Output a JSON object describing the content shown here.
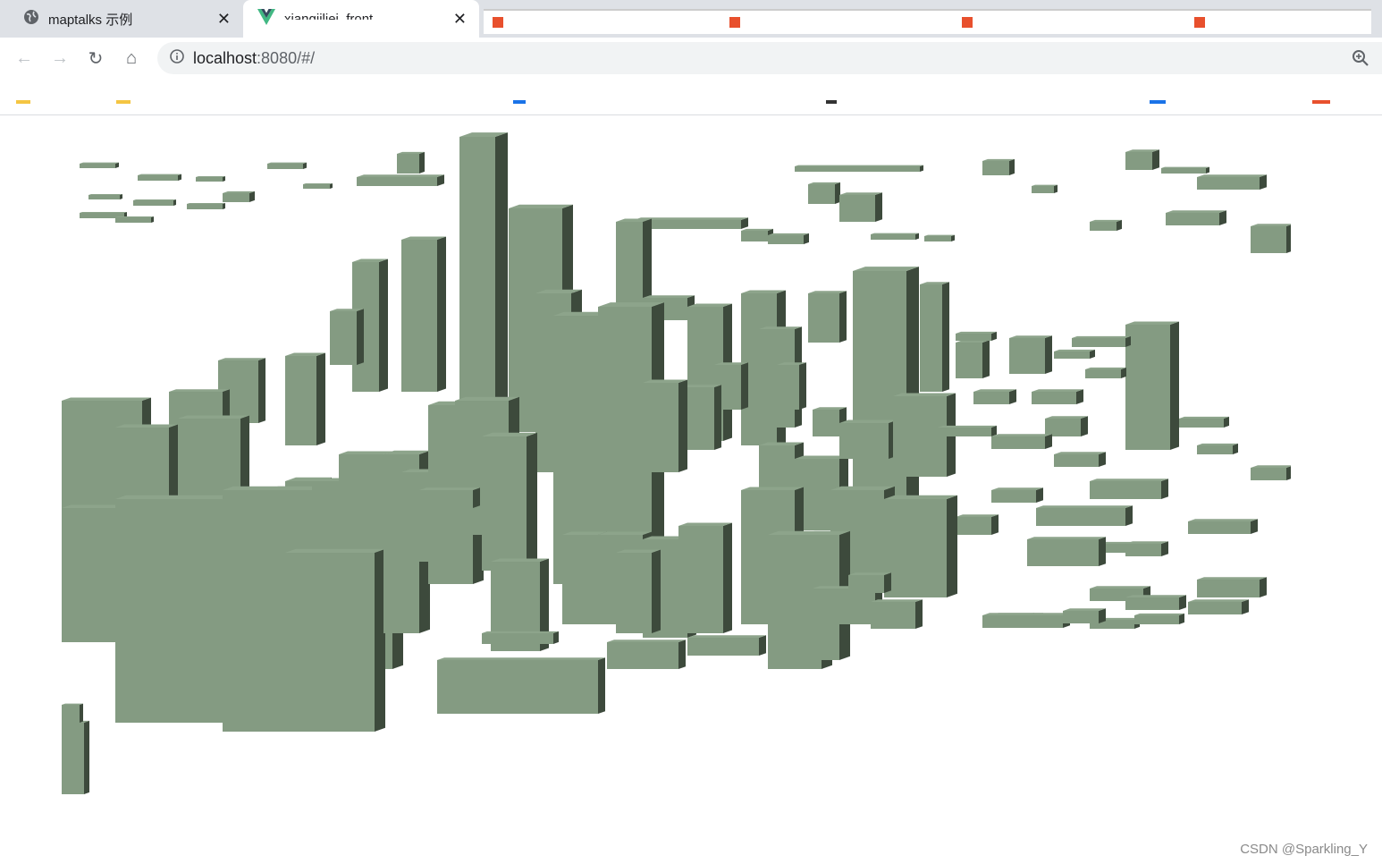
{
  "tabs": [
    {
      "title": "maptalks 示例",
      "close": "✕",
      "icon": "globe-icon"
    },
    {
      "title": "xiangjiliei_front",
      "close": "✕",
      "icon": "vue-logo-icon"
    }
  ],
  "toolbar": {
    "back": "←",
    "forward": "→",
    "reload": "↻",
    "home": "⌂",
    "url_host": "localhost",
    "url_path": ":8080/#/"
  },
  "map": {
    "building_color": "#849b82",
    "shadow_color": "#3d4a3c",
    "roof_color": "#8da48b"
  },
  "watermark": "CSDN @Sparkling_Y"
}
